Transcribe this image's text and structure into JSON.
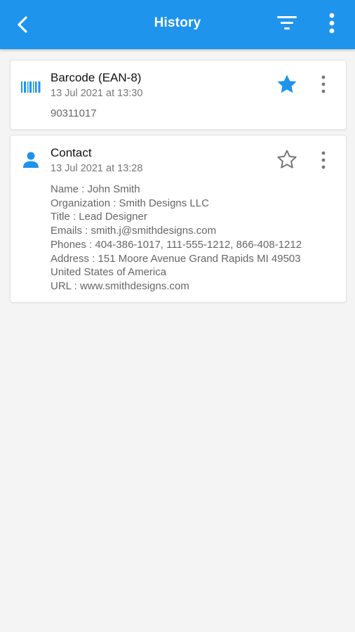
{
  "appbar": {
    "title": "History",
    "background": "#1e94ec"
  },
  "history": [
    {
      "type_icon": "barcode-icon",
      "title": "Barcode (EAN-8)",
      "date": "13 Jul 2021 at 13:30",
      "value": "90311017",
      "favorite": true
    },
    {
      "type_icon": "person-icon",
      "title": "Contact",
      "date": "13 Jul 2021 at 13:28",
      "favorite": false,
      "details": [
        "Name : John  Smith",
        "Organization : Smith Designs LLC",
        "Title : Lead Designer",
        "Emails : smith.j@smithdesigns.com",
        "Phones : 404-386-1017, 111-555-1212, 866-408-1212",
        "Address : 151 Moore Avenue Grand Rapids MI 49503",
        "United States of America",
        "URL : www.smithdesigns.com"
      ]
    }
  ],
  "colors": {
    "accent": "#1e94ec",
    "star_active": "#1e94ec",
    "text_primary": "#111111",
    "text_secondary": "#777777"
  }
}
